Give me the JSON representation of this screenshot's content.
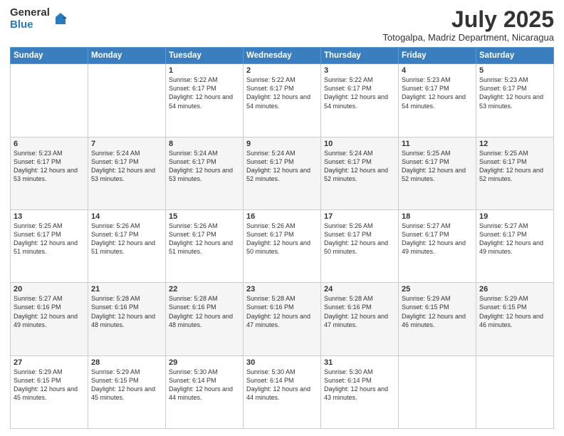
{
  "logo": {
    "general": "General",
    "blue": "Blue"
  },
  "title": "July 2025",
  "location": "Totogalpa, Madriz Department, Nicaragua",
  "days_of_week": [
    "Sunday",
    "Monday",
    "Tuesday",
    "Wednesday",
    "Thursday",
    "Friday",
    "Saturday"
  ],
  "weeks": [
    [
      null,
      null,
      {
        "day": 1,
        "sunrise": "5:22 AM",
        "sunset": "6:17 PM",
        "daylight": "12 hours and 54 minutes."
      },
      {
        "day": 2,
        "sunrise": "5:22 AM",
        "sunset": "6:17 PM",
        "daylight": "12 hours and 54 minutes."
      },
      {
        "day": 3,
        "sunrise": "5:22 AM",
        "sunset": "6:17 PM",
        "daylight": "12 hours and 54 minutes."
      },
      {
        "day": 4,
        "sunrise": "5:23 AM",
        "sunset": "6:17 PM",
        "daylight": "12 hours and 54 minutes."
      },
      {
        "day": 5,
        "sunrise": "5:23 AM",
        "sunset": "6:17 PM",
        "daylight": "12 hours and 53 minutes."
      }
    ],
    [
      {
        "day": 6,
        "sunrise": "5:23 AM",
        "sunset": "6:17 PM",
        "daylight": "12 hours and 53 minutes."
      },
      {
        "day": 7,
        "sunrise": "5:24 AM",
        "sunset": "6:17 PM",
        "daylight": "12 hours and 53 minutes."
      },
      {
        "day": 8,
        "sunrise": "5:24 AM",
        "sunset": "6:17 PM",
        "daylight": "12 hours and 53 minutes."
      },
      {
        "day": 9,
        "sunrise": "5:24 AM",
        "sunset": "6:17 PM",
        "daylight": "12 hours and 52 minutes."
      },
      {
        "day": 10,
        "sunrise": "5:24 AM",
        "sunset": "6:17 PM",
        "daylight": "12 hours and 52 minutes."
      },
      {
        "day": 11,
        "sunrise": "5:25 AM",
        "sunset": "6:17 PM",
        "daylight": "12 hours and 52 minutes."
      },
      {
        "day": 12,
        "sunrise": "5:25 AM",
        "sunset": "6:17 PM",
        "daylight": "12 hours and 52 minutes."
      }
    ],
    [
      {
        "day": 13,
        "sunrise": "5:25 AM",
        "sunset": "6:17 PM",
        "daylight": "12 hours and 51 minutes."
      },
      {
        "day": 14,
        "sunrise": "5:26 AM",
        "sunset": "6:17 PM",
        "daylight": "12 hours and 51 minutes."
      },
      {
        "day": 15,
        "sunrise": "5:26 AM",
        "sunset": "6:17 PM",
        "daylight": "12 hours and 51 minutes."
      },
      {
        "day": 16,
        "sunrise": "5:26 AM",
        "sunset": "6:17 PM",
        "daylight": "12 hours and 50 minutes."
      },
      {
        "day": 17,
        "sunrise": "5:26 AM",
        "sunset": "6:17 PM",
        "daylight": "12 hours and 50 minutes."
      },
      {
        "day": 18,
        "sunrise": "5:27 AM",
        "sunset": "6:17 PM",
        "daylight": "12 hours and 49 minutes."
      },
      {
        "day": 19,
        "sunrise": "5:27 AM",
        "sunset": "6:17 PM",
        "daylight": "12 hours and 49 minutes."
      }
    ],
    [
      {
        "day": 20,
        "sunrise": "5:27 AM",
        "sunset": "6:16 PM",
        "daylight": "12 hours and 49 minutes."
      },
      {
        "day": 21,
        "sunrise": "5:28 AM",
        "sunset": "6:16 PM",
        "daylight": "12 hours and 48 minutes."
      },
      {
        "day": 22,
        "sunrise": "5:28 AM",
        "sunset": "6:16 PM",
        "daylight": "12 hours and 48 minutes."
      },
      {
        "day": 23,
        "sunrise": "5:28 AM",
        "sunset": "6:16 PM",
        "daylight": "12 hours and 47 minutes."
      },
      {
        "day": 24,
        "sunrise": "5:28 AM",
        "sunset": "6:16 PM",
        "daylight": "12 hours and 47 minutes."
      },
      {
        "day": 25,
        "sunrise": "5:29 AM",
        "sunset": "6:15 PM",
        "daylight": "12 hours and 46 minutes."
      },
      {
        "day": 26,
        "sunrise": "5:29 AM",
        "sunset": "6:15 PM",
        "daylight": "12 hours and 46 minutes."
      }
    ],
    [
      {
        "day": 27,
        "sunrise": "5:29 AM",
        "sunset": "6:15 PM",
        "daylight": "12 hours and 45 minutes."
      },
      {
        "day": 28,
        "sunrise": "5:29 AM",
        "sunset": "6:15 PM",
        "daylight": "12 hours and 45 minutes."
      },
      {
        "day": 29,
        "sunrise": "5:30 AM",
        "sunset": "6:14 PM",
        "daylight": "12 hours and 44 minutes."
      },
      {
        "day": 30,
        "sunrise": "5:30 AM",
        "sunset": "6:14 PM",
        "daylight": "12 hours and 44 minutes."
      },
      {
        "day": 31,
        "sunrise": "5:30 AM",
        "sunset": "6:14 PM",
        "daylight": "12 hours and 43 minutes."
      },
      null,
      null
    ]
  ]
}
